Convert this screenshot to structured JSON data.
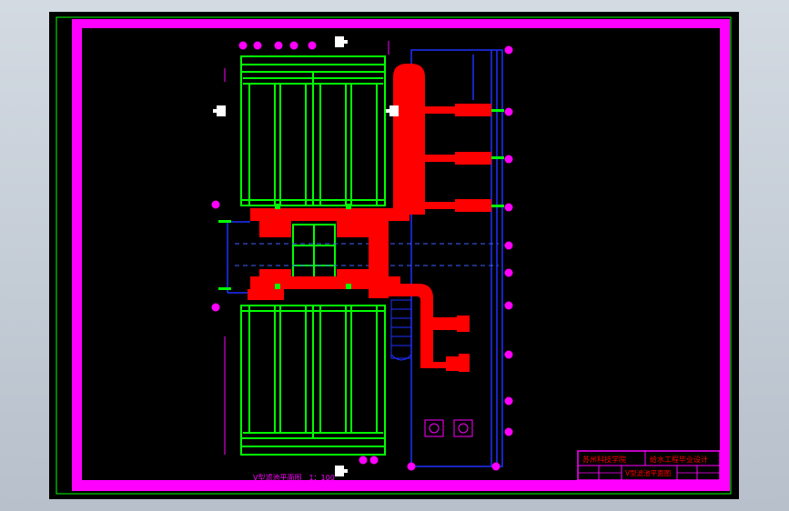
{
  "drawing": {
    "plan_title": "V型滤池平面图　1：100"
  },
  "title_block": {
    "school": "苏州科技学院",
    "project": "给水工程毕业设计",
    "drawing_name": "V型滤池平面图"
  },
  "colors": {
    "background": "#000000",
    "frame": "#ff00ff",
    "filter_cells": "#00ff00",
    "pipes": "#ff0000",
    "channels": "#0000ff",
    "markers": "#ff00ff",
    "title_text": "#ff0000"
  }
}
